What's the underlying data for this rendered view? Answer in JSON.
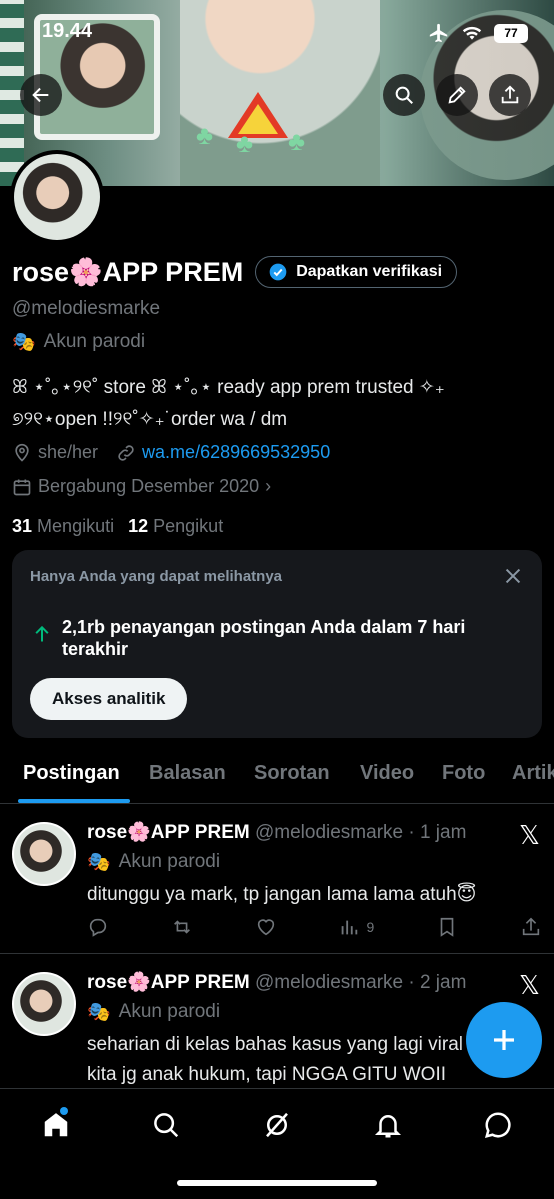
{
  "status": {
    "time": "19.44",
    "battery": "77"
  },
  "profile": {
    "name": "rose🌸APP PREM",
    "verify_label": "Dapatkan verifikasi",
    "handle": "@melodiesmarke",
    "parody": "Akun parodi",
    "bio_line1": "ꕤ ⋆˚｡⋆୨୧˚ store ꕤ ⋆˚｡⋆ ready app prem trusted ✧₊",
    "bio_line2": "୭୨୧⋆open !!୨୧˚✧₊˙order wa / dm",
    "pronouns": "she/her",
    "link": "wa.me/6289669532950",
    "joined": "Bergabung Desember 2020",
    "following_count": "31",
    "following_label": "Mengikuti",
    "followers_count": "12",
    "followers_label": "Pengikut"
  },
  "analytics": {
    "caption": "Hanya Anda yang dapat melihatnya",
    "stat": "2,1rb penayangan postingan Anda dalam 7 hari terakhir",
    "button": "Akses analitik"
  },
  "tabs": [
    "Postingan",
    "Balasan",
    "Sorotan",
    "Video",
    "Foto",
    "Artikel"
  ],
  "posts": [
    {
      "name": "rose🌸APP PREM",
      "handle_time": "@melodiesmarke · 1 jam",
      "parody": "Akun parodi",
      "text": "ditunggu ya mark, tp jangan lama lama atuh😇",
      "views": "9"
    },
    {
      "name": "rose🌸APP PREM",
      "handle_time": "@melodiesmarke · 2 jam",
      "parody": "Akun parodi",
      "text": "seharian di kelas bahas kasus yang lagi viral karna kita jg anak hukum, tapi NGGA GITU WOII"
    }
  ],
  "icons": {
    "back": "back-arrow-icon",
    "search": "search-icon",
    "edit": "pencil-icon",
    "share": "share-icon",
    "accent": "#1d9bf0"
  }
}
